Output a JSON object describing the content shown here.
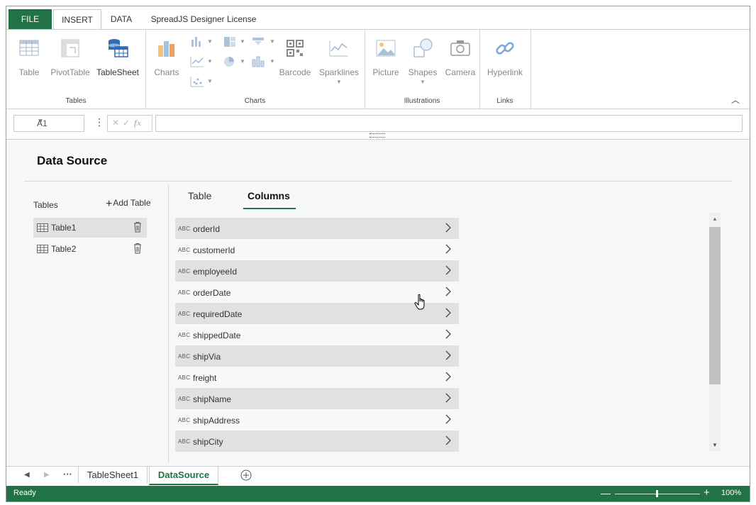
{
  "ribbon_tabs": {
    "file": "FILE",
    "insert": "INSERT",
    "data": "DATA",
    "license": "SpreadJS Designer License"
  },
  "ribbon": {
    "tables_group": {
      "label": "Tables",
      "table": "Table",
      "pivot_table": "PivotTable",
      "table_sheet": "TableSheet"
    },
    "charts_group": {
      "label": "Charts",
      "charts": "Charts",
      "barcode": "Barcode",
      "sparklines": "Sparklines"
    },
    "illustrations_group": {
      "label": "Illustrations",
      "picture": "Picture",
      "shapes": "Shapes",
      "camera": "Camera"
    },
    "links_group": {
      "label": "Links",
      "hyperlink": "Hyperlink"
    }
  },
  "formula_bar": {
    "name_box": "A1",
    "formula": ""
  },
  "data_source": {
    "title": "Data Source",
    "tables_label": "Tables",
    "add_table": "Add Table",
    "tables": [
      {
        "name": "Table1",
        "selected": true
      },
      {
        "name": "Table2",
        "selected": false
      }
    ],
    "subtabs": {
      "table": "Table",
      "columns": "Columns"
    },
    "active_subtab": "Columns",
    "columns": [
      {
        "type": "ABC",
        "name": "orderId"
      },
      {
        "type": "ABC",
        "name": "customerId"
      },
      {
        "type": "ABC",
        "name": "employeeId"
      },
      {
        "type": "ABC",
        "name": "orderDate"
      },
      {
        "type": "ABC",
        "name": "requiredDate"
      },
      {
        "type": "ABC",
        "name": "shippedDate"
      },
      {
        "type": "ABC",
        "name": "shipVia"
      },
      {
        "type": "ABC",
        "name": "freight"
      },
      {
        "type": "ABC",
        "name": "shipName"
      },
      {
        "type": "ABC",
        "name": "shipAddress"
      },
      {
        "type": "ABC",
        "name": "shipCity"
      }
    ]
  },
  "sheets": {
    "tabs": [
      "TableSheet1",
      "DataSource"
    ],
    "active": "DataSource"
  },
  "status_bar": {
    "status": "Ready",
    "zoom": "100%"
  },
  "colors": {
    "accent": "#217346",
    "row_shade": "#e1e1e1"
  }
}
